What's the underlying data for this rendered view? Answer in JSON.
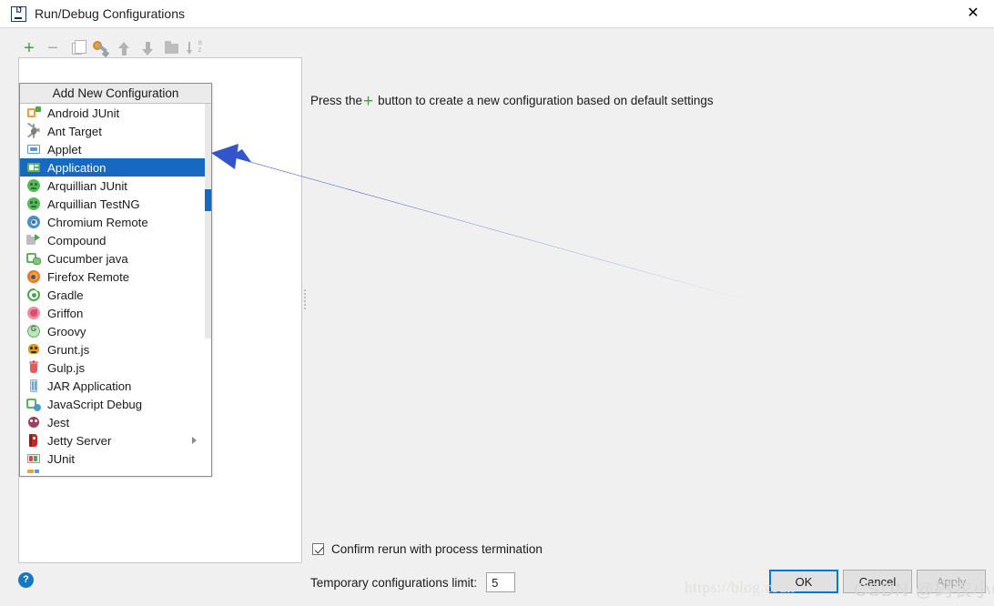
{
  "window": {
    "title": "Run/Debug Configurations",
    "app_icon": "intellij-idea-icon",
    "close_label": "✕"
  },
  "toolbar": {
    "buttons": [
      {
        "name": "add-configuration-button",
        "icon": "plus-icon",
        "label": "+"
      },
      {
        "name": "remove-configuration-button",
        "icon": "minus-icon",
        "label": "−"
      },
      {
        "name": "copy-configuration-button",
        "icon": "copy-icon",
        "label": ""
      },
      {
        "name": "edit-templates-button",
        "icon": "wrench-icon",
        "label": ""
      },
      {
        "name": "move-up-button",
        "icon": "arrow-up-icon",
        "label": ""
      },
      {
        "name": "move-down-button",
        "icon": "arrow-down-icon",
        "label": ""
      },
      {
        "name": "create-folder-button",
        "icon": "folder-icon",
        "label": ""
      },
      {
        "name": "sort-configurations-button",
        "icon": "sort-alphabetical-icon",
        "label": ""
      }
    ],
    "sort_label_a": "a",
    "sort_label_z": "z"
  },
  "popup": {
    "title": "Add New Configuration",
    "items": [
      {
        "label": "Android JUnit",
        "icon": "android-junit-icon",
        "selected": false,
        "submenu": false
      },
      {
        "label": "Ant Target",
        "icon": "ant-target-icon",
        "selected": false,
        "submenu": false
      },
      {
        "label": "Applet",
        "icon": "applet-icon",
        "selected": false,
        "submenu": false
      },
      {
        "label": "Application",
        "icon": "application-icon",
        "selected": true,
        "submenu": false
      },
      {
        "label": "Arquillian JUnit",
        "icon": "arquillian-junit-icon",
        "selected": false,
        "submenu": false
      },
      {
        "label": "Arquillian TestNG",
        "icon": "arquillian-testng-icon",
        "selected": false,
        "submenu": false
      },
      {
        "label": "Chromium Remote",
        "icon": "chromium-remote-icon",
        "selected": false,
        "submenu": false
      },
      {
        "label": "Compound",
        "icon": "compound-icon",
        "selected": false,
        "submenu": false
      },
      {
        "label": "Cucumber java",
        "icon": "cucumber-java-icon",
        "selected": false,
        "submenu": false
      },
      {
        "label": "Firefox Remote",
        "icon": "firefox-remote-icon",
        "selected": false,
        "submenu": false
      },
      {
        "label": "Gradle",
        "icon": "gradle-icon",
        "selected": false,
        "submenu": false
      },
      {
        "label": "Griffon",
        "icon": "griffon-icon",
        "selected": false,
        "submenu": false
      },
      {
        "label": "Groovy",
        "icon": "groovy-icon",
        "selected": false,
        "submenu": false
      },
      {
        "label": "Grunt.js",
        "icon": "grunt-js-icon",
        "selected": false,
        "submenu": false
      },
      {
        "label": "Gulp.js",
        "icon": "gulp-js-icon",
        "selected": false,
        "submenu": false
      },
      {
        "label": "JAR Application",
        "icon": "jar-application-icon",
        "selected": false,
        "submenu": false
      },
      {
        "label": "JavaScript Debug",
        "icon": "javascript-debug-icon",
        "selected": false,
        "submenu": false
      },
      {
        "label": "Jest",
        "icon": "jest-icon",
        "selected": false,
        "submenu": false
      },
      {
        "label": "Jetty Server",
        "icon": "jetty-server-icon",
        "selected": false,
        "submenu": true
      },
      {
        "label": "JUnit",
        "icon": "junit-icon",
        "selected": false,
        "submenu": false
      }
    ],
    "groovy_letter": "G",
    "selection_color": "#1668c1"
  },
  "main": {
    "hint_prefix": "Press the",
    "hint_plus": "+",
    "hint_suffix": "button to create a new configuration based on default settings"
  },
  "options": {
    "confirm_rerun_label": "Confirm rerun with process termination",
    "confirm_rerun_checked": true,
    "temp_limit_label": "Temporary configurations limit:",
    "temp_limit_value": "5"
  },
  "footer": {
    "help_label": "?",
    "ok_label": "OK",
    "cancel_label": "Cancel",
    "apply_label": "Apply",
    "apply_enabled": false
  },
  "watermark": {
    "url": "https://blog.csdn",
    "author": "CSDN @码农小C"
  },
  "annotation": {
    "arrow_color": "#3355cc",
    "description": "arrow pointing to Application list item"
  }
}
